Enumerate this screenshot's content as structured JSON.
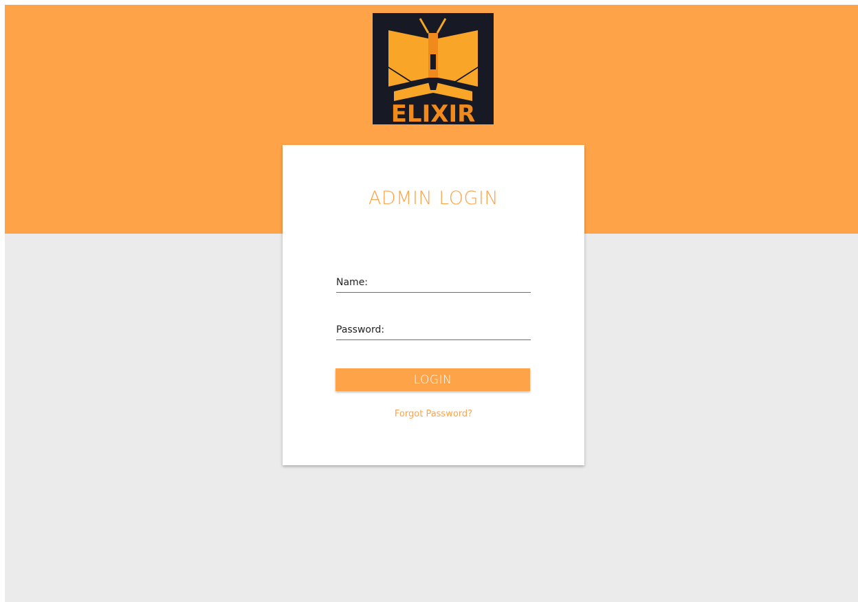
{
  "brand": {
    "logo_text": "ELIXIR",
    "logo_icon": "open-book-flask-icon",
    "colors": {
      "accent": "#ffa348",
      "logo_background": "#171a24",
      "page_background": "#ebebeb",
      "card_background": "#ffffff"
    }
  },
  "login": {
    "title": "ADMIN LOGIN",
    "name_label": "Name:",
    "name_value": "",
    "password_label": "Password:",
    "password_value": "",
    "submit_label": "LOGIN",
    "forgot_label": "Forgot Password?"
  }
}
